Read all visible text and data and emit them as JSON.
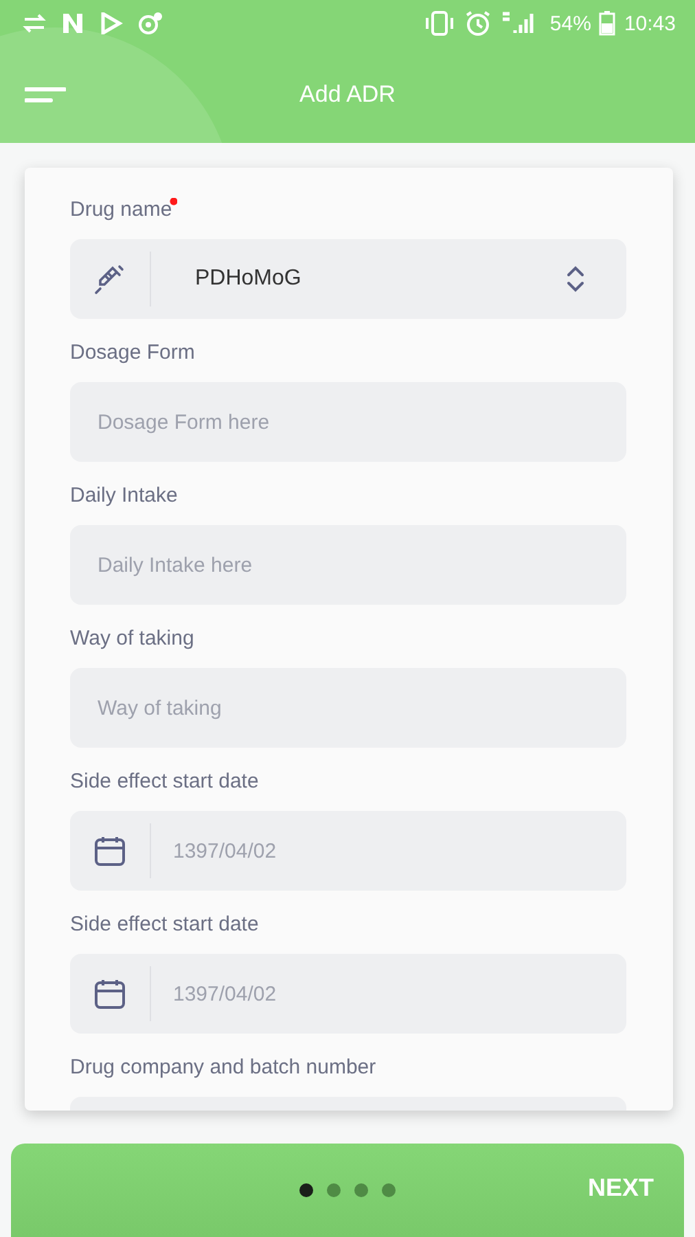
{
  "status_bar": {
    "battery": "54%",
    "time": "10:43"
  },
  "app_bar": {
    "title": "Add ADR"
  },
  "fields": [
    {
      "kind": "select",
      "label": "Drug name",
      "required": true,
      "value": "PDHoMoG"
    },
    {
      "kind": "text",
      "label": "Dosage Form",
      "required": false,
      "placeholder": "Dosage Form here"
    },
    {
      "kind": "text",
      "label": "Daily Intake",
      "required": false,
      "placeholder": "Daily Intake here"
    },
    {
      "kind": "text",
      "label": "Way of taking",
      "required": false,
      "placeholder": "Way of taking"
    },
    {
      "kind": "date",
      "label": "Side effect start date",
      "required": false,
      "placeholder": "1397/04/02"
    },
    {
      "kind": "date",
      "label": "Side effect start date",
      "required": false,
      "placeholder": "1397/04/02"
    },
    {
      "kind": "text",
      "label": "Drug company and batch number",
      "required": false
    }
  ],
  "pager": {
    "pages": [
      {
        "selected": true
      },
      {
        "selected": false
      },
      {
        "selected": false
      },
      {
        "selected": false
      }
    ],
    "next": "NEXT"
  }
}
